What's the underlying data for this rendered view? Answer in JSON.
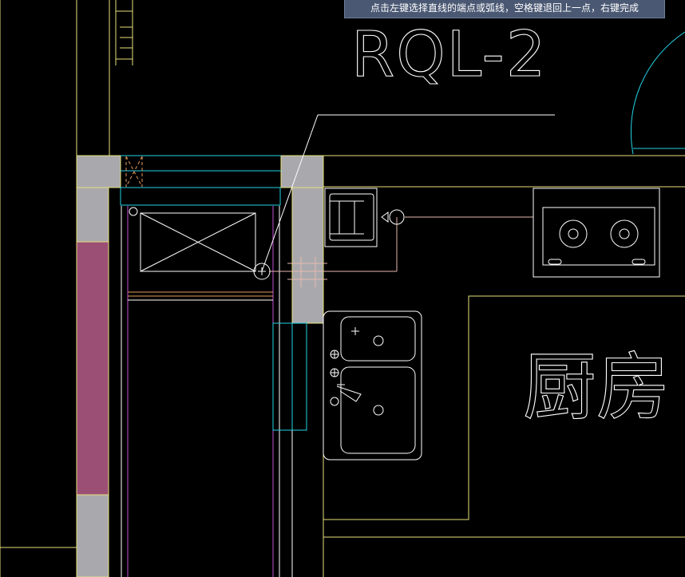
{
  "status_prompt": "点击左键选择直线的端点或弧线，空格键退回上一点，右键完成",
  "pipe_tag": "RQL-2",
  "room_label": "厨房",
  "colors": {
    "background": "#000000",
    "wall_fill": "#a9a9ad",
    "column_fill": "#9b4f75",
    "line_yellow": "#e8e07a",
    "line_cyan": "#22d3e6",
    "line_magenta": "#c54fd6",
    "line_orange": "#e89a5c",
    "line_white": "#ffffff",
    "pipe_pink": "#e7b9b0",
    "tooltip_bg": "#4a5873"
  }
}
